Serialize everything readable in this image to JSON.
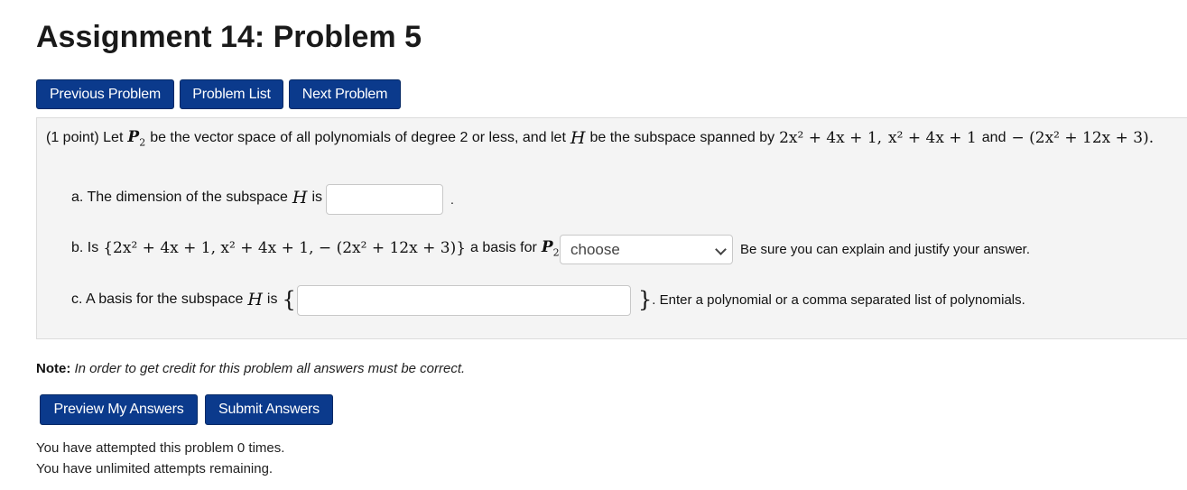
{
  "title": "Assignment 14: Problem 5",
  "nav": {
    "prev": "Previous Problem",
    "list": "Problem List",
    "next": "Next Problem"
  },
  "problem": {
    "intro_prefix": "(1 point) Let",
    "space_symbol": "P",
    "space_sub": "2",
    "intro_mid": "be the vector space of all polynomials of degree 2 or less, and let",
    "subspace_symbol": "H",
    "intro_mid2": "be the subspace spanned by",
    "poly1": "2x² + 4x + 1,",
    "poly2": "x² + 4x + 1",
    "and_word": "and",
    "poly3": "− (2x² + 12x + 3).",
    "part_a_label": "a. The dimension of the subspace",
    "part_a_is": "is",
    "part_a_value": "",
    "part_a_trail": ".",
    "part_b_label": "b. Is",
    "part_b_set": "{2x² + 4x + 1, x² + 4x + 1, − (2x² + 12x + 3)}",
    "part_b_mid": "a basis for",
    "part_b_q": "?",
    "part_b_selected": "choose",
    "part_b_trail": "Be sure you can explain and justify your answer.",
    "part_c_label": "c. A basis for the subspace",
    "part_c_is": "is",
    "brace_open": "{",
    "brace_close": "}",
    "part_c_value": "",
    "part_c_trail": ". Enter a polynomial or a comma separated list of polynomials."
  },
  "note": {
    "label": "Note:",
    "text": "In order to get credit for this problem all answers must be correct."
  },
  "actions": {
    "preview": "Preview My Answers",
    "submit": "Submit Answers"
  },
  "status": {
    "attempted": "You have attempted this problem 0 times.",
    "remaining": "You have unlimited attempts remaining."
  },
  "colors": {
    "button": "#0b3a8c",
    "panel": "#f4f4f4"
  }
}
